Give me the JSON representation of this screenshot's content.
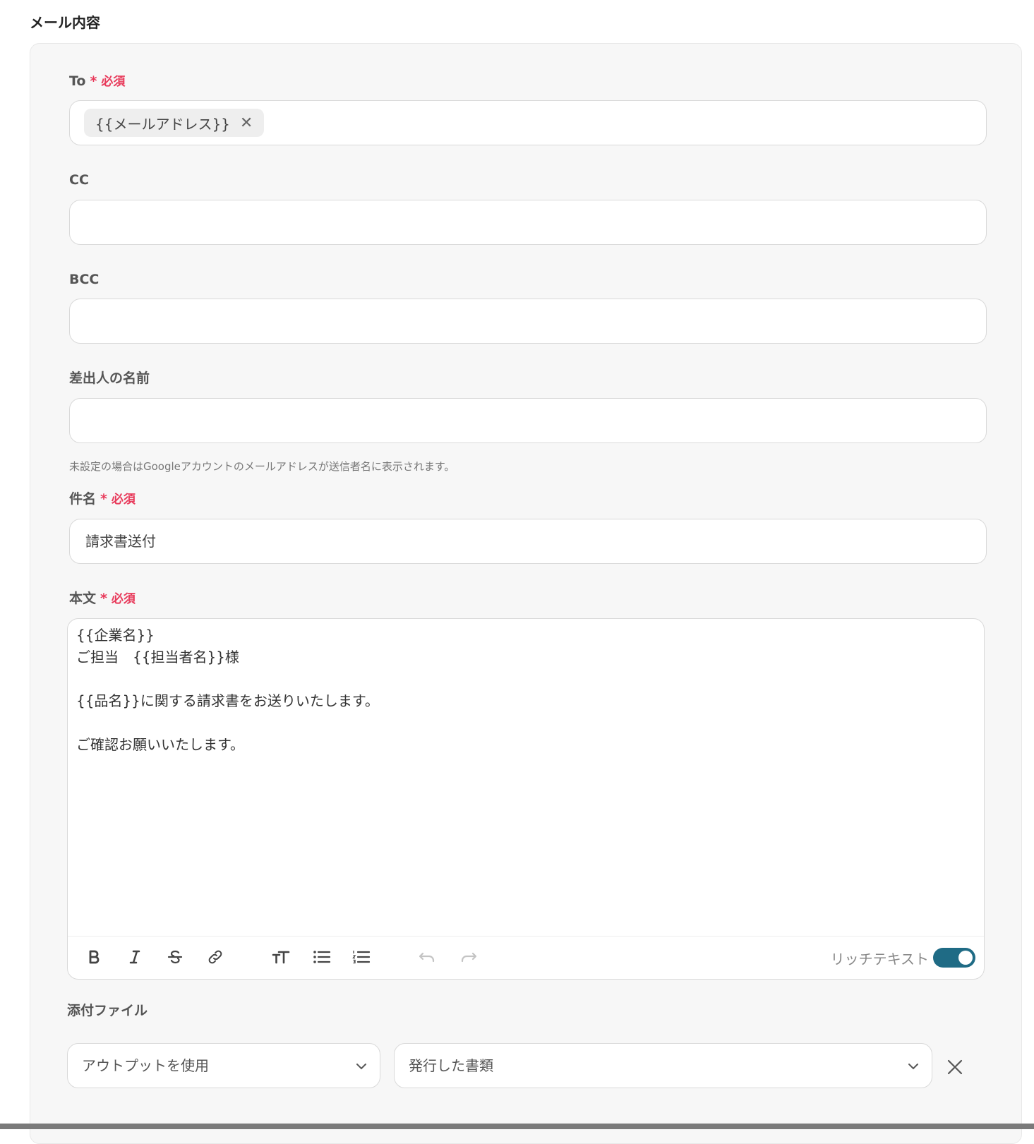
{
  "section": {
    "title": "メール内容"
  },
  "required_label": "必須",
  "required_star": "*",
  "colors": {
    "required": "#e8395a",
    "toggle_on": "#1f6b85"
  },
  "to": {
    "label": "To",
    "chip": "{{メールアドレス}}",
    "chip_remove": "✕"
  },
  "cc": {
    "label": "CC",
    "value": ""
  },
  "bcc": {
    "label": "BCC",
    "value": ""
  },
  "sender_name": {
    "label": "差出人の名前",
    "value": "",
    "hint": "未設定の場合はGoogleアカウントのメールアドレスが送信者名に表示されます。"
  },
  "subject": {
    "label": "件名",
    "value": "請求書送付"
  },
  "body": {
    "label": "本文",
    "lines": [
      "{{企業名}}",
      "ご担当　{{担当者名}}様",
      "",
      "{{品名}}に関する請求書をお送りいたします。",
      "",
      "ご確認お願いいたします。"
    ],
    "toolbar": {
      "icons": [
        "bold-icon",
        "italic-icon",
        "strikethrough-icon",
        "link-icon",
        "text-size-icon",
        "bullet-list-icon",
        "numbered-list-icon",
        "undo-icon",
        "redo-icon"
      ],
      "rich_text_label": "リッチテキスト",
      "rich_text_enabled": true
    }
  },
  "attachment": {
    "label": "添付ファイル",
    "source_select": "アウトプットを使用",
    "file_select": "発行した書類"
  }
}
